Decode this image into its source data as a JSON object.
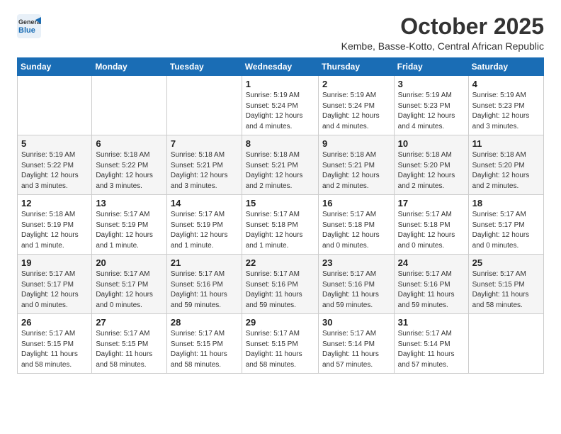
{
  "header": {
    "logo_line1": "General",
    "logo_line2": "Blue",
    "month": "October 2025",
    "location": "Kembe, Basse-Kotto, Central African Republic"
  },
  "weekdays": [
    "Sunday",
    "Monday",
    "Tuesday",
    "Wednesday",
    "Thursday",
    "Friday",
    "Saturday"
  ],
  "weeks": [
    [
      {
        "day": "",
        "info": ""
      },
      {
        "day": "",
        "info": ""
      },
      {
        "day": "",
        "info": ""
      },
      {
        "day": "1",
        "info": "Sunrise: 5:19 AM\nSunset: 5:24 PM\nDaylight: 12 hours\nand 4 minutes."
      },
      {
        "day": "2",
        "info": "Sunrise: 5:19 AM\nSunset: 5:24 PM\nDaylight: 12 hours\nand 4 minutes."
      },
      {
        "day": "3",
        "info": "Sunrise: 5:19 AM\nSunset: 5:23 PM\nDaylight: 12 hours\nand 4 minutes."
      },
      {
        "day": "4",
        "info": "Sunrise: 5:19 AM\nSunset: 5:23 PM\nDaylight: 12 hours\nand 3 minutes."
      }
    ],
    [
      {
        "day": "5",
        "info": "Sunrise: 5:19 AM\nSunset: 5:22 PM\nDaylight: 12 hours\nand 3 minutes."
      },
      {
        "day": "6",
        "info": "Sunrise: 5:18 AM\nSunset: 5:22 PM\nDaylight: 12 hours\nand 3 minutes."
      },
      {
        "day": "7",
        "info": "Sunrise: 5:18 AM\nSunset: 5:21 PM\nDaylight: 12 hours\nand 3 minutes."
      },
      {
        "day": "8",
        "info": "Sunrise: 5:18 AM\nSunset: 5:21 PM\nDaylight: 12 hours\nand 2 minutes."
      },
      {
        "day": "9",
        "info": "Sunrise: 5:18 AM\nSunset: 5:21 PM\nDaylight: 12 hours\nand 2 minutes."
      },
      {
        "day": "10",
        "info": "Sunrise: 5:18 AM\nSunset: 5:20 PM\nDaylight: 12 hours\nand 2 minutes."
      },
      {
        "day": "11",
        "info": "Sunrise: 5:18 AM\nSunset: 5:20 PM\nDaylight: 12 hours\nand 2 minutes."
      }
    ],
    [
      {
        "day": "12",
        "info": "Sunrise: 5:18 AM\nSunset: 5:19 PM\nDaylight: 12 hours\nand 1 minute."
      },
      {
        "day": "13",
        "info": "Sunrise: 5:17 AM\nSunset: 5:19 PM\nDaylight: 12 hours\nand 1 minute."
      },
      {
        "day": "14",
        "info": "Sunrise: 5:17 AM\nSunset: 5:19 PM\nDaylight: 12 hours\nand 1 minute."
      },
      {
        "day": "15",
        "info": "Sunrise: 5:17 AM\nSunset: 5:18 PM\nDaylight: 12 hours\nand 1 minute."
      },
      {
        "day": "16",
        "info": "Sunrise: 5:17 AM\nSunset: 5:18 PM\nDaylight: 12 hours\nand 0 minutes."
      },
      {
        "day": "17",
        "info": "Sunrise: 5:17 AM\nSunset: 5:18 PM\nDaylight: 12 hours\nand 0 minutes."
      },
      {
        "day": "18",
        "info": "Sunrise: 5:17 AM\nSunset: 5:17 PM\nDaylight: 12 hours\nand 0 minutes."
      }
    ],
    [
      {
        "day": "19",
        "info": "Sunrise: 5:17 AM\nSunset: 5:17 PM\nDaylight: 12 hours\nand 0 minutes."
      },
      {
        "day": "20",
        "info": "Sunrise: 5:17 AM\nSunset: 5:17 PM\nDaylight: 12 hours\nand 0 minutes."
      },
      {
        "day": "21",
        "info": "Sunrise: 5:17 AM\nSunset: 5:16 PM\nDaylight: 11 hours\nand 59 minutes."
      },
      {
        "day": "22",
        "info": "Sunrise: 5:17 AM\nSunset: 5:16 PM\nDaylight: 11 hours\nand 59 minutes."
      },
      {
        "day": "23",
        "info": "Sunrise: 5:17 AM\nSunset: 5:16 PM\nDaylight: 11 hours\nand 59 minutes."
      },
      {
        "day": "24",
        "info": "Sunrise: 5:17 AM\nSunset: 5:16 PM\nDaylight: 11 hours\nand 59 minutes."
      },
      {
        "day": "25",
        "info": "Sunrise: 5:17 AM\nSunset: 5:15 PM\nDaylight: 11 hours\nand 58 minutes."
      }
    ],
    [
      {
        "day": "26",
        "info": "Sunrise: 5:17 AM\nSunset: 5:15 PM\nDaylight: 11 hours\nand 58 minutes."
      },
      {
        "day": "27",
        "info": "Sunrise: 5:17 AM\nSunset: 5:15 PM\nDaylight: 11 hours\nand 58 minutes."
      },
      {
        "day": "28",
        "info": "Sunrise: 5:17 AM\nSunset: 5:15 PM\nDaylight: 11 hours\nand 58 minutes."
      },
      {
        "day": "29",
        "info": "Sunrise: 5:17 AM\nSunset: 5:15 PM\nDaylight: 11 hours\nand 58 minutes."
      },
      {
        "day": "30",
        "info": "Sunrise: 5:17 AM\nSunset: 5:14 PM\nDaylight: 11 hours\nand 57 minutes."
      },
      {
        "day": "31",
        "info": "Sunrise: 5:17 AM\nSunset: 5:14 PM\nDaylight: 11 hours\nand 57 minutes."
      },
      {
        "day": "",
        "info": ""
      }
    ]
  ]
}
